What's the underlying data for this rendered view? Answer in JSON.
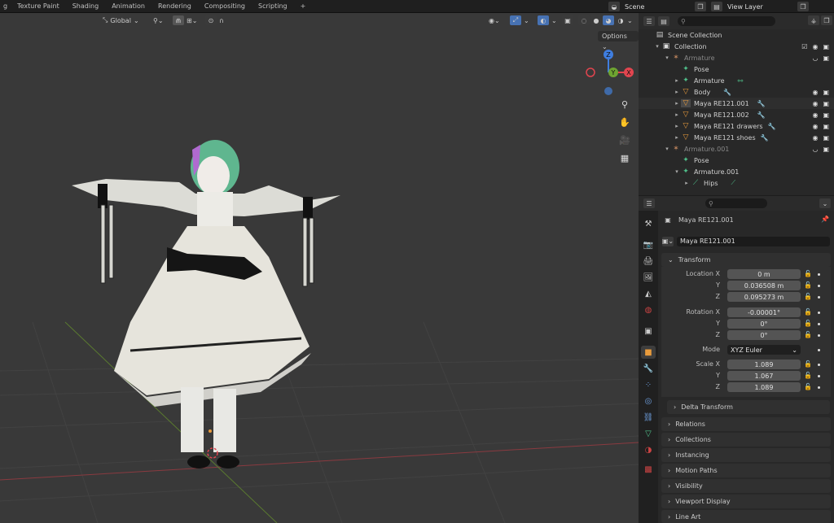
{
  "topbar": {
    "tabs": [
      "g",
      "Texture Paint",
      "Shading",
      "Animation",
      "Rendering",
      "Compositing",
      "Scripting",
      "+"
    ],
    "scene_label": "Scene",
    "view_layer_label": "View Layer"
  },
  "viewport": {
    "transform_orientation": "Global",
    "options_label": "Options",
    "gizmo": {
      "x": "X",
      "y": "Y",
      "z": "Z"
    }
  },
  "outliner": {
    "rows": [
      {
        "label": "Scene Collection",
        "icon": "scene-collection-icon",
        "dim": false
      },
      {
        "label": "Collection",
        "icon": "collection-icon",
        "dim": false
      },
      {
        "label": "Armature",
        "icon": "armature-icon",
        "dim": true
      },
      {
        "label": "Pose",
        "icon": "pose-icon",
        "dim": false
      },
      {
        "label": "Armature",
        "icon": "armature-data-icon",
        "dim": false
      },
      {
        "label": "Body",
        "icon": "mesh-icon",
        "dim": false
      },
      {
        "label": "Maya RE121.001",
        "icon": "mesh-icon",
        "dim": false
      },
      {
        "label": "Maya RE121.002",
        "icon": "mesh-icon",
        "dim": false
      },
      {
        "label": "Maya RE121 drawers",
        "icon": "mesh-icon",
        "dim": false
      },
      {
        "label": "Maya RE121 shoes",
        "icon": "mesh-icon",
        "dim": false
      },
      {
        "label": "Armature.001",
        "icon": "armature-icon",
        "dim": true
      },
      {
        "label": "Pose",
        "icon": "pose-icon",
        "dim": false
      },
      {
        "label": "Armature.001",
        "icon": "armature-data-icon",
        "dim": false
      },
      {
        "label": "Hips",
        "icon": "bone-icon",
        "dim": false
      }
    ]
  },
  "properties": {
    "object_name": "Maya RE121.001",
    "object_field": "Maya RE121.001",
    "transform_label": "Transform",
    "location": {
      "label": "Location X",
      "x": "0 m",
      "y": "0.036508 m",
      "z": "0.095273 m"
    },
    "rotation": {
      "label": "Rotation X",
      "x": "-0.00001°",
      "y": "0°",
      "z": "0°"
    },
    "mode_label": "Mode",
    "mode_value": "XYZ Euler",
    "scale": {
      "label": "Scale X",
      "x": "1.089",
      "y": "1.067",
      "z": "1.089"
    },
    "axis_y": "Y",
    "axis_z": "Z",
    "delta_transform": "Delta Transform",
    "panels": [
      "Relations",
      "Collections",
      "Instancing",
      "Motion Paths",
      "Visibility",
      "Viewport Display",
      "Line Art"
    ]
  },
  "colors": {
    "viewport_bg": "#393939",
    "x_axis": "#e2454f",
    "y_axis": "#6ea431",
    "z_axis": "#3f7ee0",
    "object_orange": "#e89b3c"
  }
}
